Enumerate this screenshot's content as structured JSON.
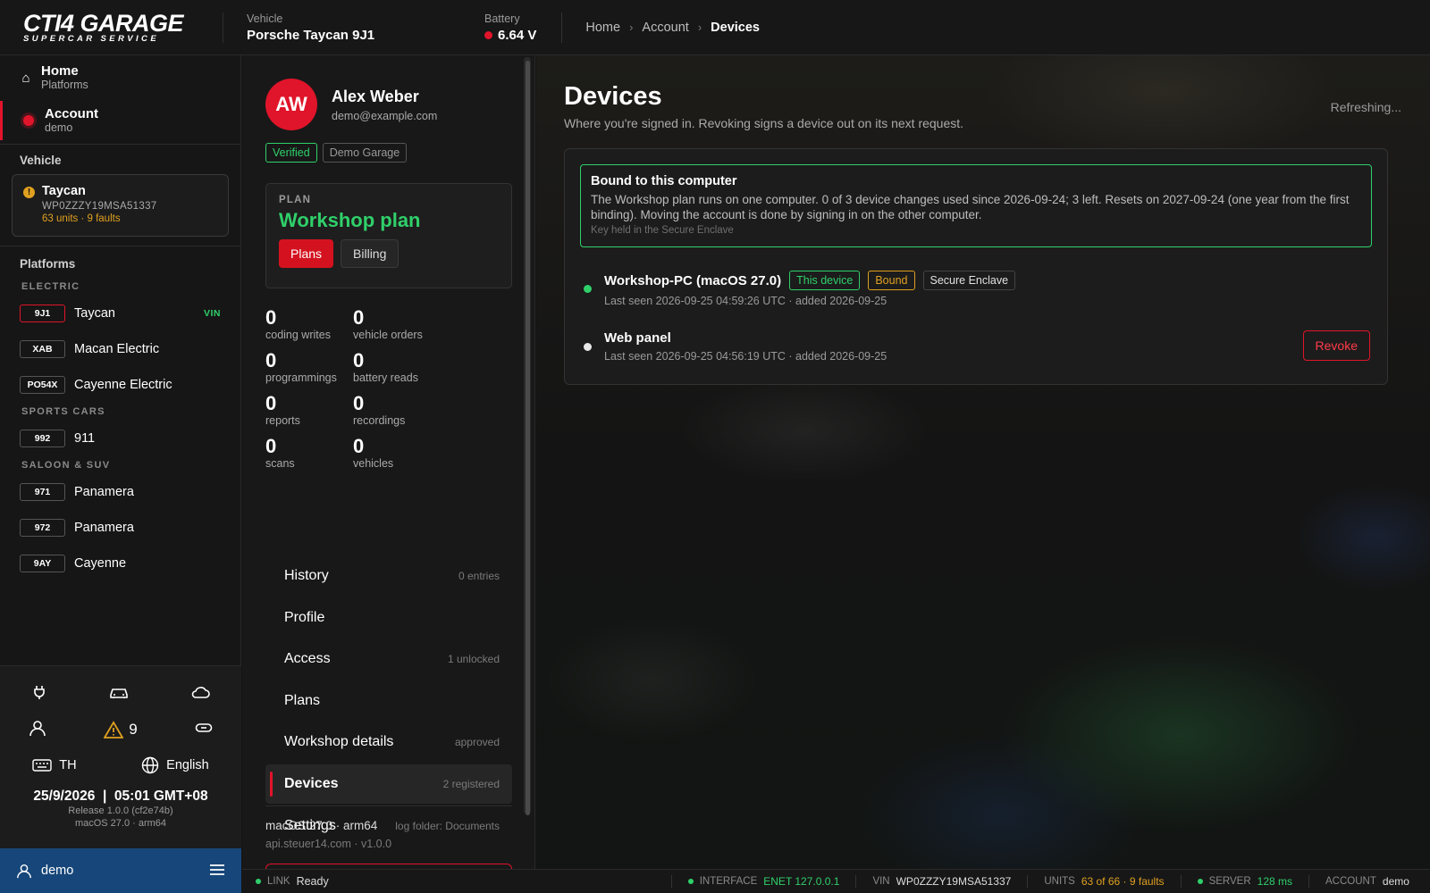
{
  "header": {
    "logo_main": "CTI4 GARAGE",
    "logo_sub": "SUPERCAR SERVICE",
    "vehicle_label": "Vehicle",
    "vehicle_value": "Porsche Taycan 9J1",
    "battery_label": "Battery",
    "battery_value": "6.64 V",
    "breadcrumb": [
      "Home",
      "Account",
      "Devices"
    ]
  },
  "sidebar": {
    "nav": [
      {
        "title": "Home",
        "sub": "Platforms"
      },
      {
        "title": "Account",
        "sub": "demo"
      }
    ],
    "vehicle_section": "Vehicle",
    "vehicle_card": {
      "name": "Taycan",
      "vin": "WP0ZZZY19MSA51337",
      "faults": "63 units · 9 faults"
    },
    "platforms_section": "Platforms",
    "groups": [
      {
        "label": "ELECTRIC",
        "items": [
          {
            "code": "9J1",
            "name": "Taycan",
            "tag": "VIN"
          },
          {
            "code": "XAB",
            "name": "Macan Electric"
          },
          {
            "code": "PO54X",
            "name": "Cayenne Electric"
          }
        ]
      },
      {
        "label": "SPORTS CARS",
        "items": [
          {
            "code": "992",
            "name": "911"
          }
        ]
      },
      {
        "label": "SALOON & SUV",
        "items": [
          {
            "code": "971",
            "name": "Panamera"
          },
          {
            "code": "972",
            "name": "Panamera"
          },
          {
            "code": "9AY",
            "name": "Cayenne"
          }
        ]
      }
    ],
    "warning_count": "9",
    "keyboard": "TH",
    "language": "English",
    "date": "25/9/2026",
    "time": "05:01 GMT+08",
    "release": "Release 1.0.0 (cf2e74b)",
    "os": "macOS 27.0 · arm64",
    "user": "demo"
  },
  "account": {
    "initials": "AW",
    "name": "Alex Weber",
    "email": "demo@example.com",
    "badges": [
      "Verified",
      "Demo Garage"
    ],
    "plan_label": "PLAN",
    "plan_name": "Workshop plan",
    "plans_button": "Plans",
    "billing_button": "Billing",
    "stats": [
      {
        "num": "0",
        "label": "coding writes"
      },
      {
        "num": "0",
        "label": "vehicle orders"
      },
      {
        "num": "0",
        "label": "programmings"
      },
      {
        "num": "0",
        "label": "battery reads"
      },
      {
        "num": "0",
        "label": "reports"
      },
      {
        "num": "0",
        "label": "recordings"
      },
      {
        "num": "0",
        "label": "scans"
      },
      {
        "num": "0",
        "label": "vehicles"
      }
    ],
    "menu": [
      {
        "label": "History",
        "meta": "0 entries"
      },
      {
        "label": "Profile",
        "meta": ""
      },
      {
        "label": "Access",
        "meta": "1 unlocked"
      },
      {
        "label": "Plans",
        "meta": ""
      },
      {
        "label": "Workshop details",
        "meta": "approved"
      },
      {
        "label": "Devices",
        "meta": "2 registered"
      },
      {
        "label": "Settings",
        "meta": "log folder: Documents"
      }
    ],
    "sys_main": "macOS 27.0 · arm64",
    "sys_sub": "api.steuer14.com  ·  v1.0.0"
  },
  "devices": {
    "title": "Devices",
    "subtitle": "Where you're signed in. Revoking signs a device out on its next request.",
    "refreshing": "Refreshing...",
    "bound_title": "Bound to this computer",
    "bound_text": "The Workshop plan runs on one computer. 0 of 3 device changes used since 2026-09-24; 3 left. Resets on 2027-09-24 (one year from the first binding). Moving the account is done by signing in on the other computer.",
    "bound_note": "Key held in the Secure Enclave",
    "list": [
      {
        "name": "Workshop-PC (macOS 27.0)",
        "tags": [
          "This device",
          "Bound",
          "Secure Enclave"
        ],
        "meta": "Last seen 2026-09-25  04:59:26 UTC  ·  added 2026-09-25"
      },
      {
        "name": "Web panel",
        "meta": "Last seen 2026-09-25  04:56:19 UTC  ·  added 2026-09-25",
        "action": "Revoke"
      }
    ]
  },
  "statusbar": {
    "link_label": "LINK",
    "link_value": "Ready",
    "interface_label": "INTERFACE",
    "interface_value": "ENET 127.0.0.1",
    "vin_label": "VIN",
    "vin_value": "WP0ZZZY19MSA51337",
    "units_label": "UNITS",
    "units_value": "63 of 66 · 9 faults",
    "server_label": "SERVER",
    "server_value": "128 ms",
    "account_label": "ACCOUNT",
    "account_value": "demo"
  },
  "colors": {
    "accent_red": "#e0142a",
    "ok_green": "#2fd06a",
    "warn_amber": "#e0a020",
    "user_bar_blue": "#17477a"
  }
}
